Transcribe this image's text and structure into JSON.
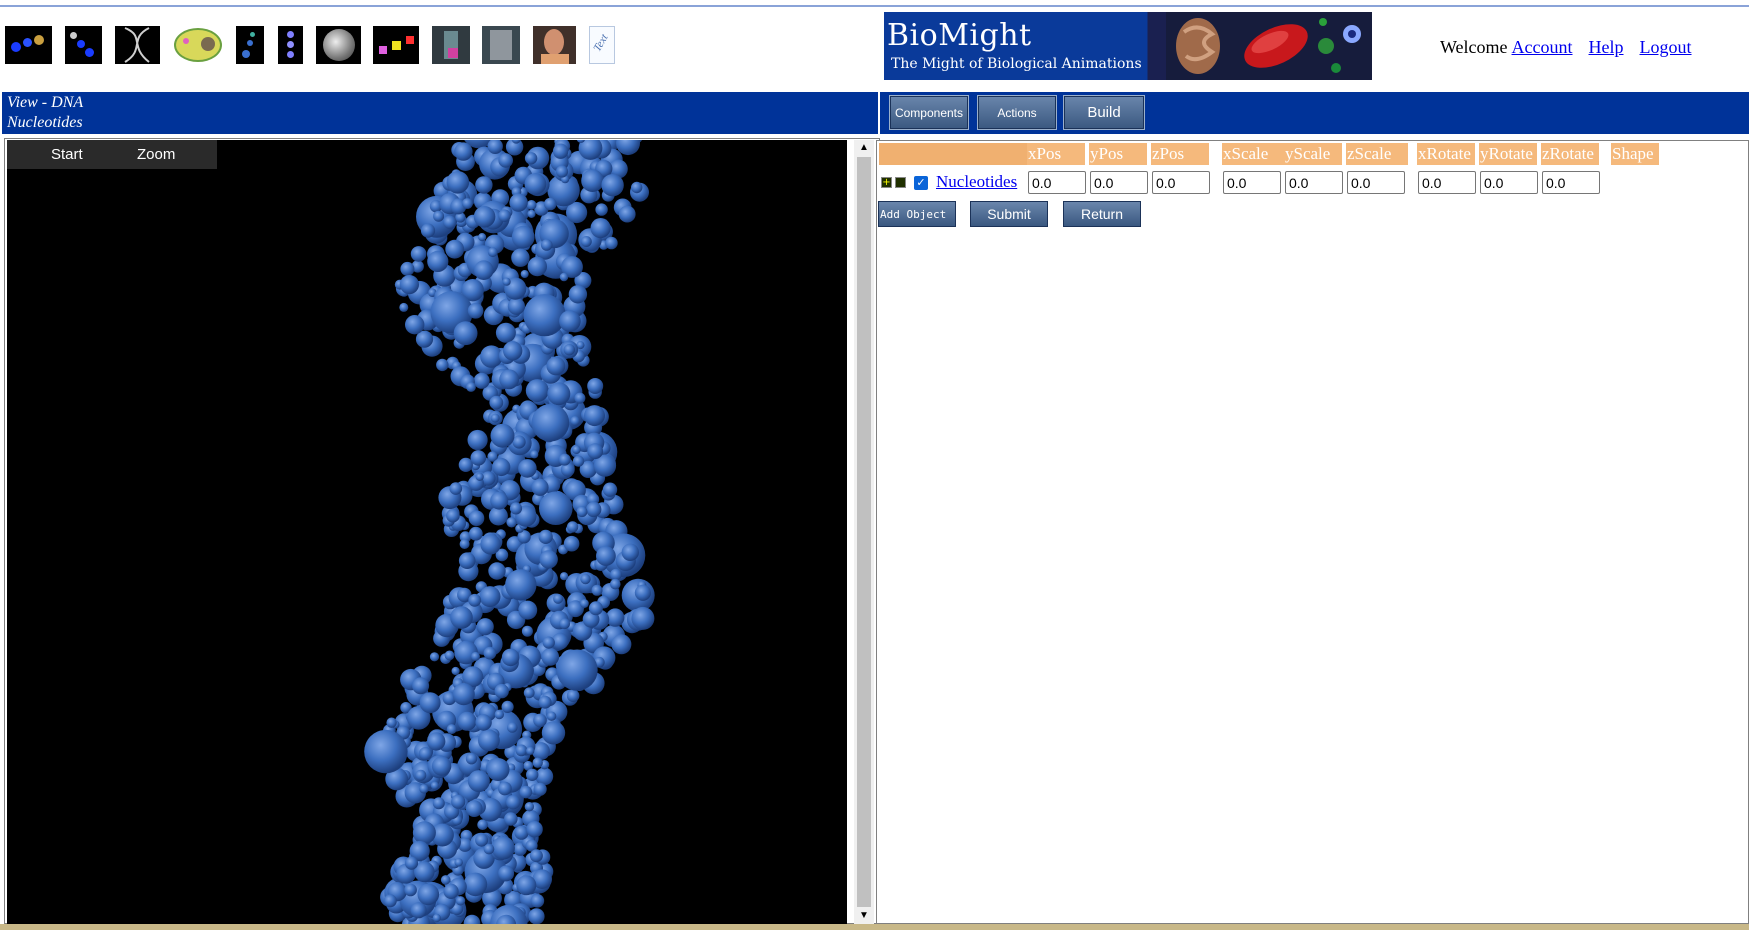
{
  "banner": {
    "title": "BioMight",
    "subtitle": "The Might of Biological Animations"
  },
  "header": {
    "welcome": "Welcome",
    "account": "Account",
    "help": "Help",
    "logout": "Logout"
  },
  "view": {
    "line1": "View - DNA",
    "line2": "Nucleotides"
  },
  "viewer": {
    "start": "Start",
    "zoom": "Zoom"
  },
  "toolbar": {
    "components": "Components",
    "actions": "Actions",
    "build": "Build"
  },
  "table": {
    "headers": [
      "xPos",
      "yPos",
      "zPos",
      "xScale",
      "yScale",
      "zScale",
      "xRotate",
      "yRotate",
      "zRotate",
      "Shape"
    ],
    "row": {
      "name": "Nucleotides",
      "checked": true,
      "values": [
        "0.0",
        "0.0",
        "0.0",
        "0.0",
        "0.0",
        "0.0",
        "0.0",
        "0.0",
        "0.0"
      ]
    }
  },
  "buttons": {
    "add_object": "Add Object",
    "submit": "Submit",
    "return": "Return"
  },
  "thumbnails": [
    "molecule",
    "chain",
    "helix",
    "cell",
    "strand",
    "column",
    "sphere",
    "cubes",
    "figure",
    "skeleton",
    "head",
    "text"
  ],
  "text_thumb": "Text",
  "colors": {
    "bar_blue": "#003399",
    "header_orange": "#f5b97c",
    "sphere_blue": "#3c6fc0"
  }
}
